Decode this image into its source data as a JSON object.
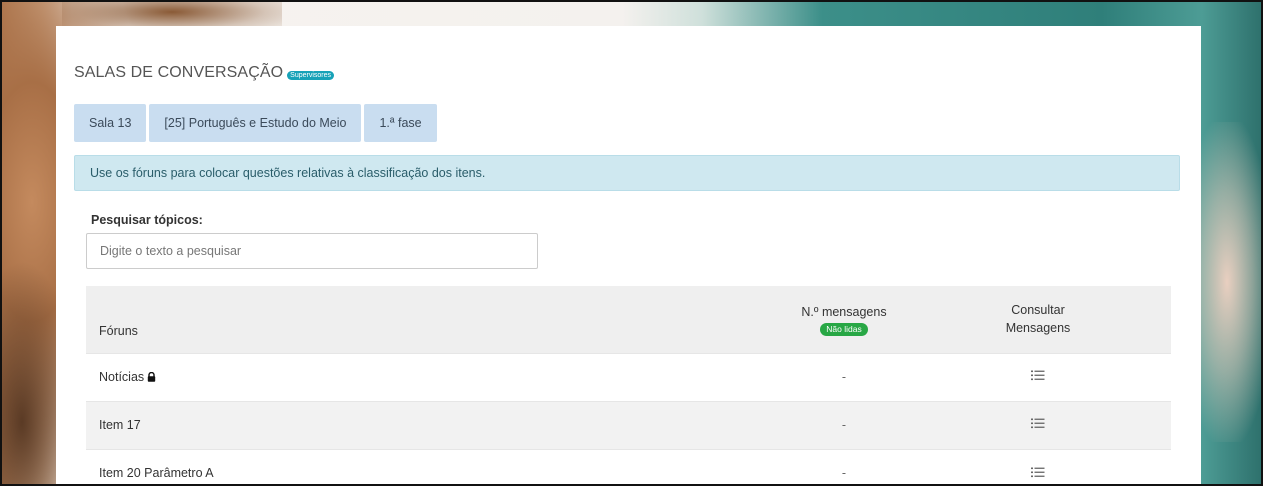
{
  "header": {
    "title": "SALAS DE CONVERSAÇÃO",
    "role_badge": "Supervisores"
  },
  "breadcrumbs": [
    {
      "label": "Sala 13"
    },
    {
      "label": "[25] Português e Estudo do Meio"
    },
    {
      "label": "1.ª fase"
    }
  ],
  "alert": {
    "text": "Use os fóruns para colocar questões relativas à classificação dos itens."
  },
  "search": {
    "label": "Pesquisar tópicos:",
    "placeholder": "Digite o texto a pesquisar",
    "value": ""
  },
  "table": {
    "headers": {
      "forum": "Fóruns",
      "count_line1": "N.º mensagens",
      "count_badge": "Não lidas",
      "view_line1": "Consultar",
      "view_line2": "Mensagens"
    },
    "rows": [
      {
        "forum": "Notícias",
        "locked": true,
        "count": "-",
        "action_icon": "list-icon"
      },
      {
        "forum": "Item 17",
        "locked": false,
        "count": "-",
        "action_icon": "list-icon"
      },
      {
        "forum": "Item 20 Parâmetro A",
        "locked": false,
        "count": "-",
        "action_icon": "list-icon"
      }
    ]
  },
  "colors": {
    "breadcrumb_bg": "#c9ddf0",
    "alert_bg": "#cfe8f0",
    "role_badge_bg": "#17a2b8",
    "unread_badge_bg": "#28a745",
    "header_row_bg": "#efefef"
  }
}
